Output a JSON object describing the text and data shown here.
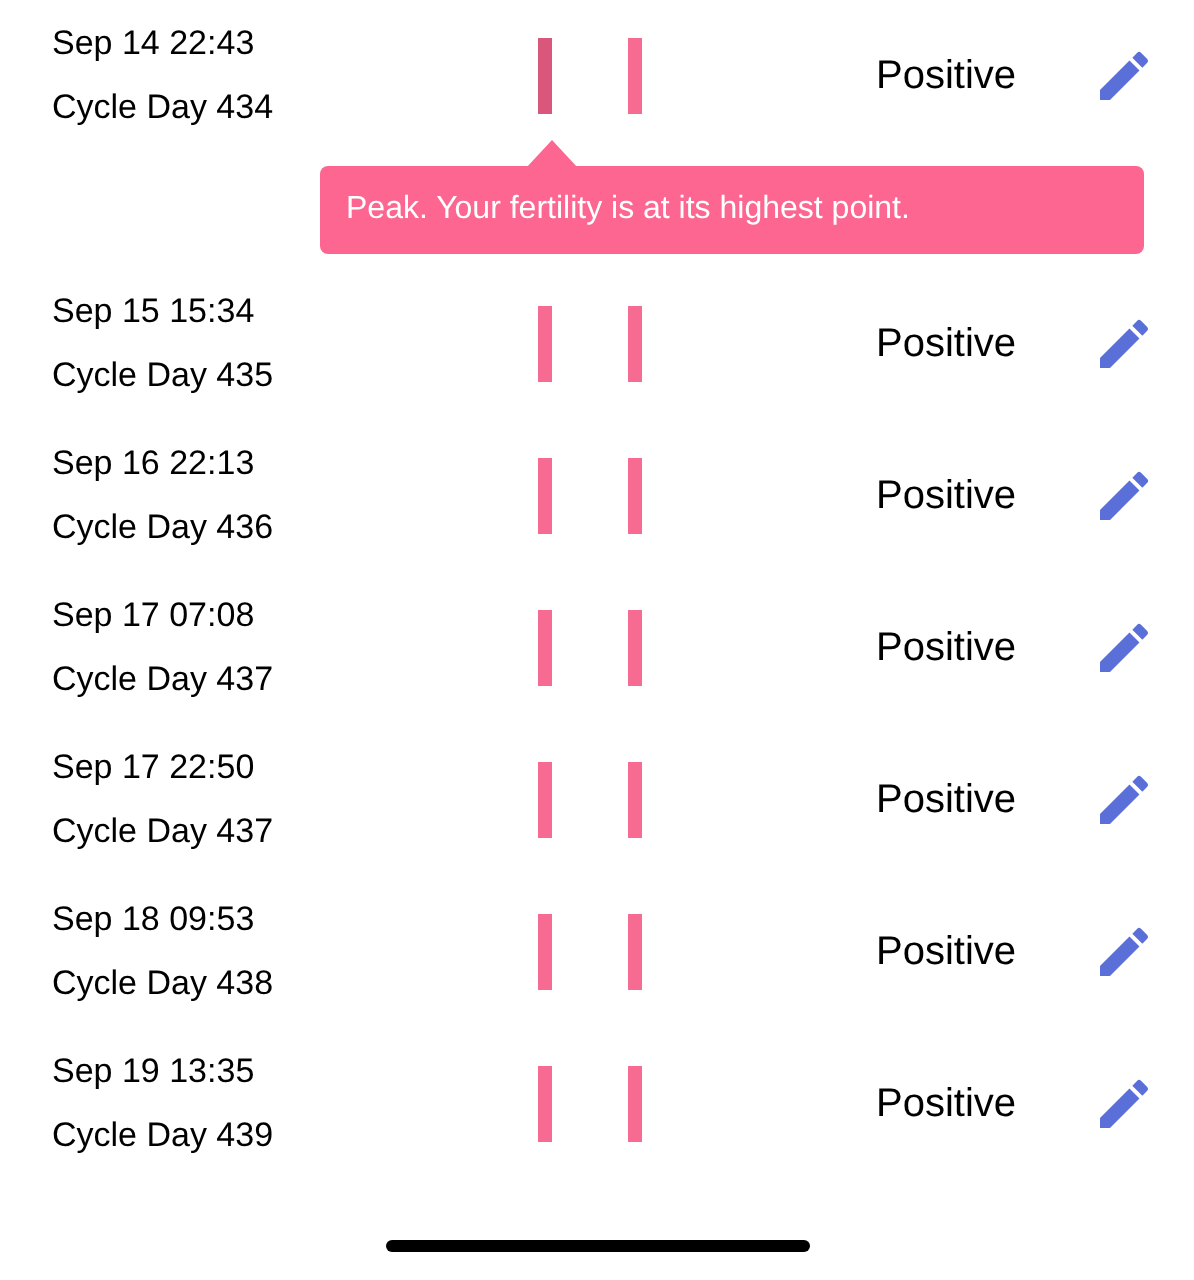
{
  "entries": [
    {
      "datetime": "Sep 14 22:43",
      "cycle_day": "Cycle Day 434",
      "result": "Positive",
      "selected": true,
      "tooltip": "Peak. Your fertility is at its highest point."
    },
    {
      "datetime": "Sep 15 15:34",
      "cycle_day": "Cycle Day 435",
      "result": "Positive",
      "selected": false
    },
    {
      "datetime": "Sep 16 22:13",
      "cycle_day": "Cycle Day 436",
      "result": "Positive",
      "selected": false
    },
    {
      "datetime": "Sep 17 07:08",
      "cycle_day": "Cycle Day 437",
      "result": "Positive",
      "selected": false
    },
    {
      "datetime": "Sep 17 22:50",
      "cycle_day": "Cycle Day 437",
      "result": "Positive",
      "selected": false
    },
    {
      "datetime": "Sep 18 09:53",
      "cycle_day": "Cycle Day 438",
      "result": "Positive",
      "selected": false
    },
    {
      "datetime": "Sep 19 13:35",
      "cycle_day": "Cycle Day 439",
      "result": "Positive",
      "selected": false
    }
  ]
}
